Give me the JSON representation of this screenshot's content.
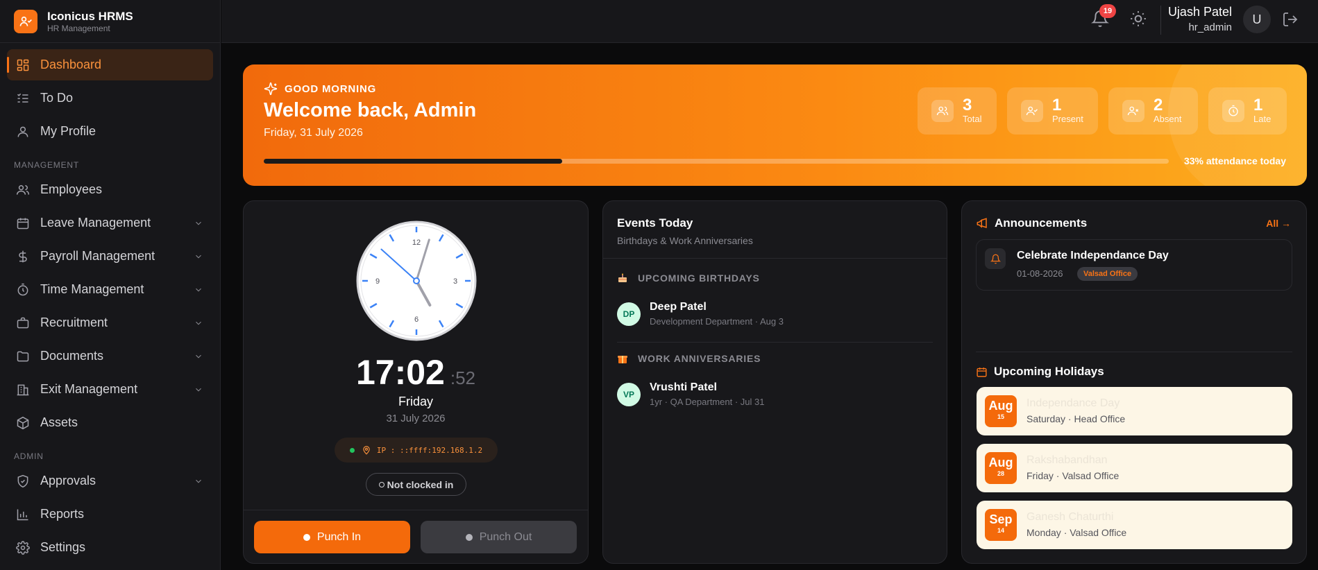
{
  "brand": {
    "name": "Iconicus HRMS",
    "subtitle": "HR Management"
  },
  "sidebar": {
    "items": [
      {
        "label": "Dashboard",
        "icon": "dashboard-icon",
        "active": true
      },
      {
        "label": "To Do",
        "icon": "todo-list-icon"
      },
      {
        "label": "My Profile",
        "icon": "user-icon"
      }
    ],
    "management_label": "MANAGEMENT",
    "management": [
      {
        "label": "Employees",
        "icon": "users-icon"
      },
      {
        "label": "Leave Management",
        "icon": "calendar-icon"
      },
      {
        "label": "Payroll Management",
        "icon": "dollar-icon"
      },
      {
        "label": "Time Management",
        "icon": "timer-icon"
      },
      {
        "label": "Recruitment",
        "icon": "briefcase-icon"
      },
      {
        "label": "Documents",
        "icon": "folder-icon"
      },
      {
        "label": "Exit Management",
        "icon": "building-icon"
      },
      {
        "label": "Assets",
        "icon": "box-icon"
      }
    ],
    "admin_label": "ADMIN",
    "admin": [
      {
        "label": "Approvals",
        "icon": "shield-check-icon"
      },
      {
        "label": "Reports",
        "icon": "bar-chart-icon"
      },
      {
        "label": "Settings",
        "icon": "gear-icon"
      }
    ]
  },
  "topbar": {
    "notification_count": "19",
    "user_name": "Ujash Patel",
    "user_role": "hr_admin",
    "avatar_initial": "U"
  },
  "hero": {
    "greeting": "GOOD MORNING",
    "welcome": "Welcome back, Admin",
    "date": "Friday, 31 July 2026",
    "stats": [
      {
        "value": "3",
        "label": "Total"
      },
      {
        "value": "1",
        "label": "Present"
      },
      {
        "value": "2",
        "label": "Absent"
      },
      {
        "value": "1",
        "label": "Late"
      }
    ],
    "attendance_fraction": 0.33,
    "attendance_text": "33% attendance today"
  },
  "clock": {
    "hour": "17",
    "minute": "02",
    "hm": "17:02",
    "second": ":52",
    "day": "Friday",
    "date": "31 July 2026",
    "ip": "IP : ::ffff:192.168.1.2",
    "status": "Not clocked in",
    "punch_in": "Punch In",
    "punch_out": "Punch Out",
    "numerals": [
      "12",
      "3",
      "6",
      "9"
    ]
  },
  "events": {
    "title": "Events Today",
    "subtitle": "Birthdays & Work Anniversaries",
    "birthdays_label": "UPCOMING BIRTHDAYS",
    "birthdays": [
      {
        "initials": "DP",
        "name": "Deep Patel",
        "meta": "Development Department · Aug 3"
      }
    ],
    "anniversaries_label": "WORK ANNIVERSARIES",
    "anniversaries": [
      {
        "initials": "VP",
        "name": "Vrushti Patel",
        "meta": "1yr · QA Department · Jul 31"
      }
    ]
  },
  "announcements": {
    "title": "Announcements",
    "all_link": "All →",
    "items": [
      {
        "title": "Celebrate Independance Day",
        "date": "01-08-2026",
        "tag": "Valsad Office"
      }
    ]
  },
  "holidays": {
    "title": "Upcoming Holidays",
    "items": [
      {
        "month": "Aug",
        "day": "15",
        "name": "Independance Day",
        "meta": "Saturday · Head Office"
      },
      {
        "month": "Aug",
        "day": "28",
        "name": "Rakshabandhan",
        "meta": "Friday · Valsad Office"
      },
      {
        "month": "Sep",
        "day": "14",
        "name": "Ganesh Chaturthi",
        "meta": "Monday · Valsad Office"
      }
    ]
  },
  "colors": {
    "accent": "#f97316",
    "hero_start": "#f16a0c",
    "hero_end": "#fdae1e",
    "holiday_bg": "#fdf6e6"
  }
}
